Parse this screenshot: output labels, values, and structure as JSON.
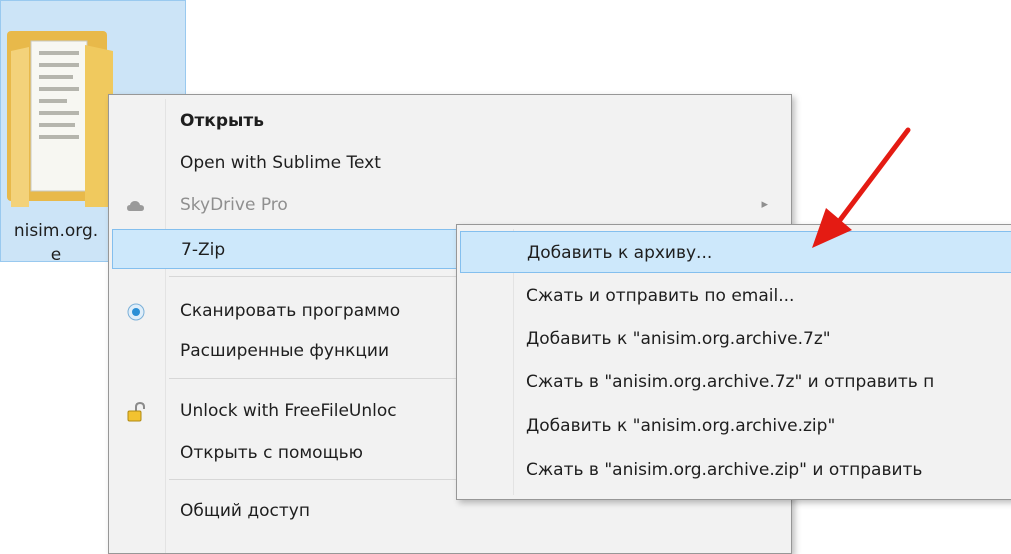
{
  "desktop": {
    "folder": {
      "name_line1": "nisim.org.",
      "name_line2": "e"
    }
  },
  "context_menu": {
    "items": [
      {
        "label": "Открыть"
      },
      {
        "label": "Open with Sublime Text"
      },
      {
        "label": "SkyDrive Pro",
        "icon": "cloud-icon",
        "submenu_arrow": "▸"
      },
      {
        "label": "7-Zip"
      },
      {
        "label": "Сканировать программо",
        "icon": "scan-icon"
      },
      {
        "label": "Расширенные функции"
      },
      {
        "label": "Unlock with FreeFileUnloc",
        "icon": "unlock-icon"
      },
      {
        "label": "Открыть с помощью"
      },
      {
        "label": "Общий доступ"
      }
    ]
  },
  "submenu": {
    "items": [
      {
        "label": "Добавить к архиву..."
      },
      {
        "label": "Сжать и отправить по email..."
      },
      {
        "label": "Добавить к \"anisim.org.archive.7z\""
      },
      {
        "label": "Сжать в \"anisim.org.archive.7z\" и отправить п"
      },
      {
        "label": "Добавить к \"anisim.org.archive.zip\""
      },
      {
        "label": "Сжать в \"anisim.org.archive.zip\" и отправить"
      }
    ]
  },
  "colors": {
    "highlight": "#cde8fb",
    "highlight_border": "#84bfee",
    "annotation_arrow": "#e41b13",
    "folder": "#f3d27a"
  }
}
